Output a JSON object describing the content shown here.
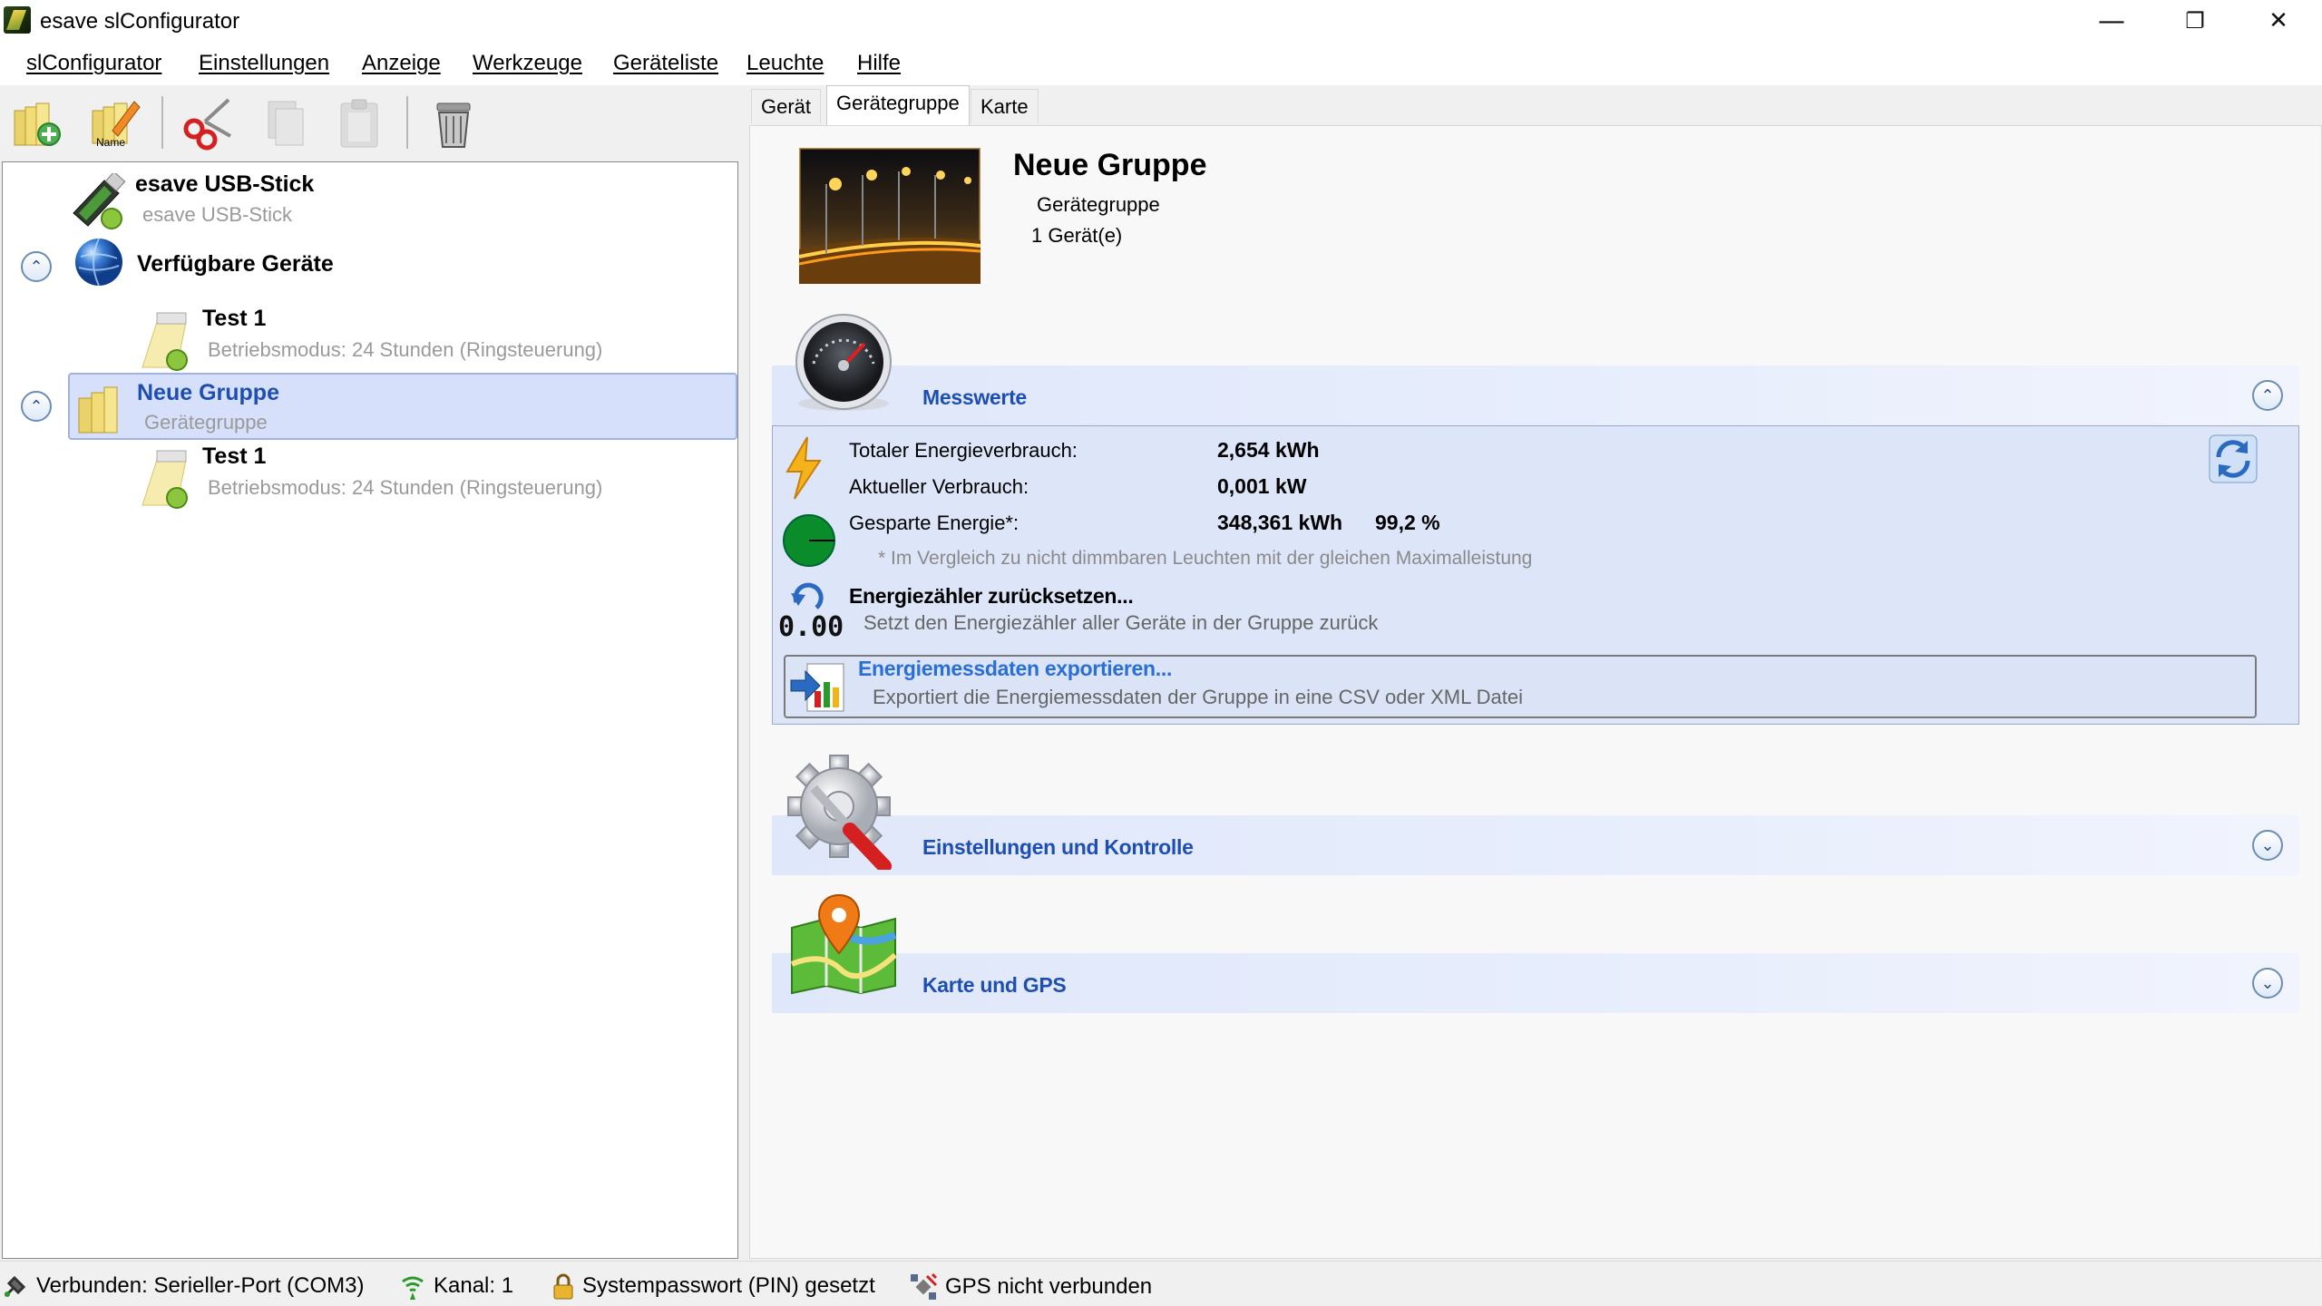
{
  "window": {
    "title": "esave slConfigurator",
    "controls": {
      "minimize": "—",
      "restore": "❐",
      "close": "✕"
    }
  },
  "menu": [
    "slConfigurator",
    "Einstellungen",
    "Anzeige",
    "Werkzeuge",
    "Geräteliste",
    "Leuchte",
    "Hilfe"
  ],
  "toolbar": {
    "name_button_caption": "Name",
    "icons": [
      "new-group-icon",
      "rename-icon",
      "cut-icon",
      "copy-icon",
      "paste-icon",
      "trash-icon"
    ]
  },
  "tabs": [
    "Gerät",
    "Gerätegruppe",
    "Karte"
  ],
  "tree": {
    "stick": {
      "title": "esave USB-Stick",
      "subtitle": "esave USB-Stick"
    },
    "available": {
      "title": "Verfügbare Geräte"
    },
    "available_device": {
      "title": "Test 1",
      "subtitle": "Betriebsmodus: 24 Stunden (Ringsteuerung)"
    },
    "group": {
      "title": "Neue Gruppe",
      "subtitle": "Gerätegruppe"
    },
    "group_device": {
      "title": "Test 1",
      "subtitle": "Betriebsmodus: 24 Stunden (Ringsteuerung)"
    }
  },
  "header": {
    "title": "Neue Gruppe",
    "type": "Gerätegruppe",
    "count": "1 Gerät(e)"
  },
  "messwerte": {
    "title": "Messwerte",
    "total_label": "Totaler Energieverbrauch:",
    "total_value": "2,654 kWh",
    "current_label": "Aktueller Verbrauch:",
    "current_value": "0,001 kW",
    "saved_label": "Gesparte Energie*:",
    "saved_value": "348,361 kWh",
    "saved_percent": "99,2 %",
    "footnote": "* Im Vergleich zu nicht dimmbaren Leuchten mit der gleichen Maximalleistung",
    "reset_title": "Energiezähler zurücksetzen...",
    "reset_desc": "Setzt den Energiezähler aller Geräte in der Gruppe zurück",
    "reset_icon_text": "0.00",
    "export_title": "Energiemessdaten exportieren...",
    "export_desc": "Exportiert die Energiemessdaten der Gruppe in eine CSV oder XML Datei"
  },
  "sections": {
    "settings": "Einstellungen und Kontrolle",
    "map": "Karte und GPS"
  },
  "status": {
    "connection": "Verbunden: Serieller-Port (COM3)",
    "channel": "Kanal: 1",
    "password": "Systempasswort (PIN) gesetzt",
    "gps": "GPS nicht verbunden"
  },
  "colors": {
    "accent": "#1e4fb0",
    "selection": "#d6e0fa",
    "section_header": "#dfe7fa",
    "messwerte_body": "#dde5f8"
  }
}
